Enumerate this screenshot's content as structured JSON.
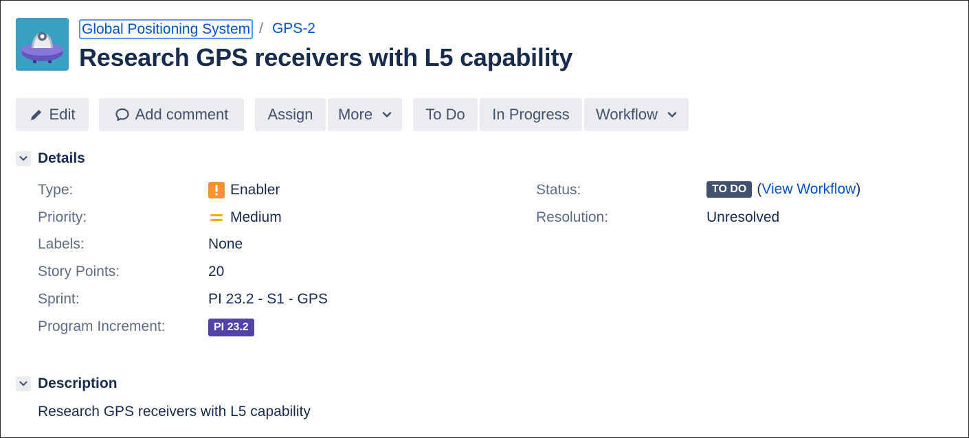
{
  "breadcrumb": {
    "project": "Global Positioning System",
    "separator": "/",
    "issue_key": "GPS-2"
  },
  "issue": {
    "title": "Research GPS receivers with L5 capability"
  },
  "toolbar": {
    "edit": "Edit",
    "add_comment": "Add comment",
    "assign": "Assign",
    "more": "More",
    "todo": "To Do",
    "in_progress": "In Progress",
    "workflow": "Workflow"
  },
  "details": {
    "heading": "Details",
    "type_label": "Type:",
    "type_value": "Enabler",
    "type_icon": "exclamation-icon",
    "priority_label": "Priority:",
    "priority_value": "Medium",
    "priority_icon": "medium-priority-icon",
    "labels_label": "Labels:",
    "labels_value": "None",
    "story_points_label": "Story Points:",
    "story_points_value": "20",
    "sprint_label": "Sprint:",
    "sprint_value": "PI 23.2 - S1 - GPS",
    "pi_label": "Program Increment:",
    "pi_value": "PI 23.2",
    "status_label": "Status:",
    "status_value": "TO DO",
    "view_workflow_open": "(",
    "view_workflow": "View Workflow",
    "view_workflow_close": ")",
    "resolution_label": "Resolution:",
    "resolution_value": "Unresolved"
  },
  "description": {
    "heading": "Description",
    "text": "Research GPS receivers with L5 capability"
  },
  "colors": {
    "link": "#0052cc",
    "text": "#172b4d",
    "label": "#5e6c84",
    "button_bg": "#ebecf0",
    "status_lozenge": "#42526e",
    "pi_lozenge": "#5243aa",
    "enabler_icon": "#f79232",
    "priority_medium": "#ffab00",
    "avatar_bg": "#3aa0c3"
  }
}
